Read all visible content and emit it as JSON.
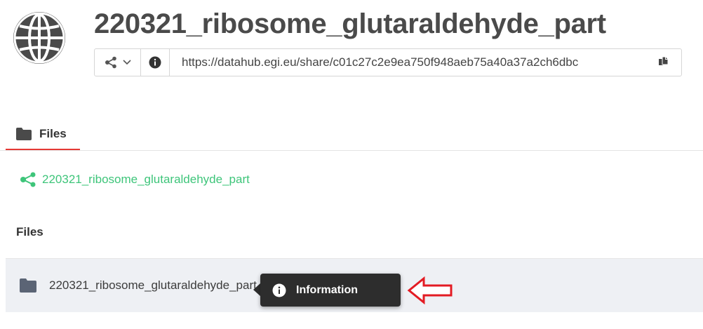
{
  "header": {
    "icon": "globe-icon",
    "title": "220321_ribosome_glutaraldehyde_part",
    "share_url": "https://datahub.egi.eu/share/c01c27c2e9ea750f948aeb75a40a37a2ch6dbc",
    "share_menu_icon": "share-icon",
    "info_icon": "info-icon",
    "copy_icon": "copy-icon"
  },
  "tabs": [
    {
      "label": "Files",
      "icon": "folder-icon",
      "active": true
    }
  ],
  "breadcrumb": {
    "icon": "share-icon",
    "label": "220321_ribosome_glutaraldehyde_part"
  },
  "files_section": {
    "heading": "Files",
    "items": [
      {
        "name": "220321_ribosome_glutaraldehyde_part",
        "icon": "folder-icon"
      }
    ]
  },
  "tooltip": {
    "icon": "info-icon",
    "label": "Information"
  },
  "colors": {
    "accent_red": "#e53935",
    "link_green": "#3ec57a",
    "tooltip_bg": "#2d2d2d",
    "row_bg": "#eef0f4"
  }
}
